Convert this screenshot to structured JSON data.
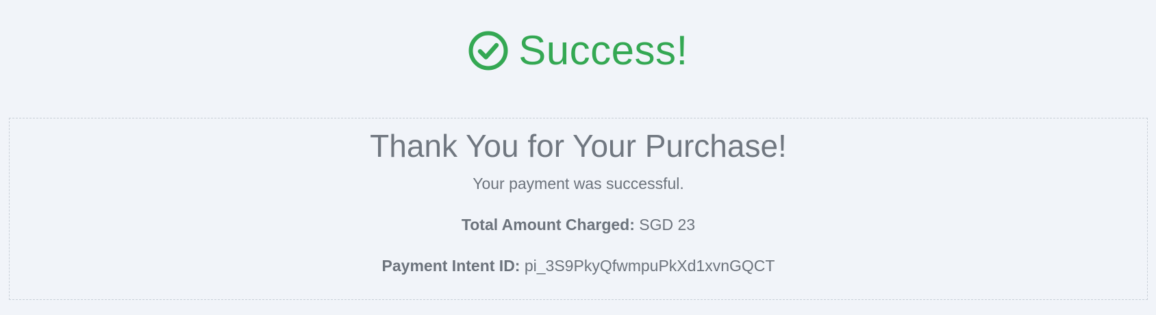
{
  "header": {
    "icon": "check-circle-icon",
    "title": "Success!",
    "accent_color": "#34a853"
  },
  "panel": {
    "title": "Thank You for Your Purchase!",
    "message": "Your payment was successful.",
    "amount": {
      "label": "Total Amount Charged:",
      "value": "SGD 23"
    },
    "intent": {
      "label": "Payment Intent ID:",
      "value": "pi_3S9PkyQfwmpuPkXd1xvnGQCT"
    }
  }
}
